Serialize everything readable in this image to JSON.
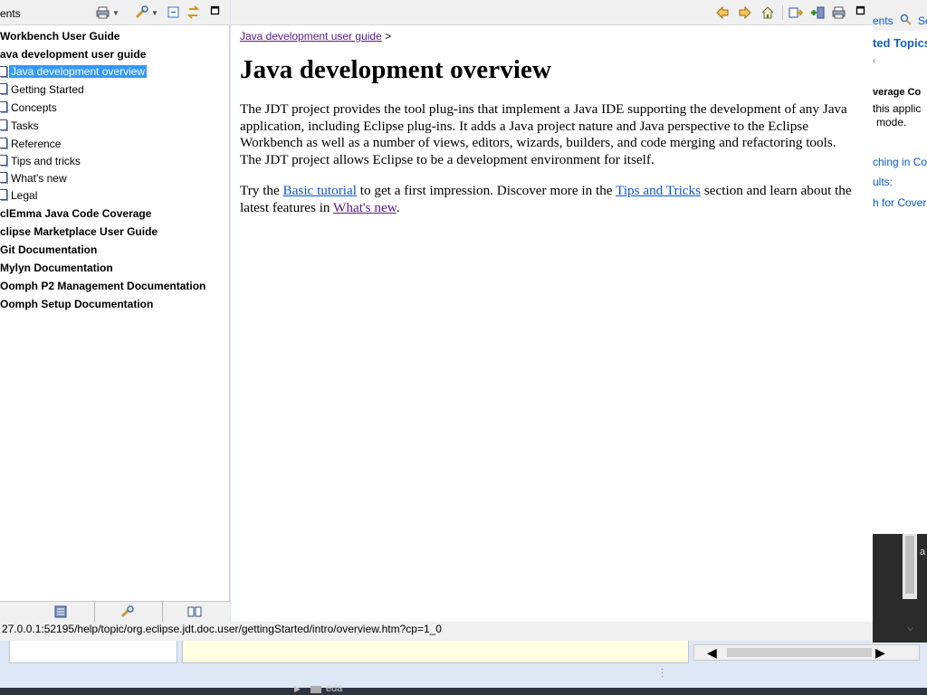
{
  "left_panel": {
    "title": "ents",
    "toc": [
      {
        "label": "Workbench User Guide",
        "kind": "book"
      },
      {
        "label": "ava development user guide",
        "kind": "book"
      },
      {
        "label": "Java development overview",
        "kind": "page",
        "selected": true
      },
      {
        "label": "Getting Started",
        "kind": "page"
      },
      {
        "label": "Concepts",
        "kind": "page"
      },
      {
        "label": "Tasks",
        "kind": "page"
      },
      {
        "label": "Reference",
        "kind": "page"
      },
      {
        "label": "Tips and tricks",
        "kind": "page"
      },
      {
        "label": "What's new",
        "kind": "page"
      },
      {
        "label": "Legal",
        "kind": "page"
      },
      {
        "label": "clEmma Java Code Coverage",
        "kind": "book"
      },
      {
        "label": "clipse Marketplace User Guide",
        "kind": "book"
      },
      {
        "label": "Git Documentation",
        "kind": "book"
      },
      {
        "label": "Mylyn Documentation",
        "kind": "book"
      },
      {
        "label": "Oomph P2 Management Documentation",
        "kind": "book"
      },
      {
        "label": "Oomph Setup Documentation",
        "kind": "book"
      }
    ],
    "bottom_tabs": [
      "contents-tab-icon",
      "search-tab-icon",
      "bookmarks-tab-icon"
    ]
  },
  "main": {
    "breadcrumb_link": "Java development user guide",
    "breadcrumb_sep": ">",
    "title": "Java development overview",
    "p1": "The JDT project provides the tool plug-ins that implement a Java IDE supporting the development of any Java application, including Eclipse plug-ins. It adds a Java project nature and Java perspective to the Eclipse Workbench as well as a number of views, editors, wizards, builders, and code merging and refactoring tools. The JDT project allows Eclipse to be a development environment for itself.",
    "p2_a": "Try the ",
    "p2_link1": "Basic tutorial",
    "p2_b": " to get a first impression. Discover more in the ",
    "p2_link2": "Tips and Tricks",
    "p2_c": " section and learn about the latest features in ",
    "p2_link3": "What's new",
    "p2_d": "."
  },
  "right_panel": {
    "tab1": "ents",
    "tab2": "Se",
    "heading": "ted Topics",
    "line1": "verage Co",
    "line2": "this applic",
    "line3": "mode.",
    "link1": "ching in Co",
    "link2": "ults:",
    "link3": "h for Cover"
  },
  "status_bar": {
    "url": "27.0.0.1:52195/help/topic/org.eclipse.jdt.doc.user/gettingStarted/intro/overview.htm?cp=1_0"
  },
  "background": {
    "taskbar_label": "eda",
    "side_text": "a"
  },
  "colors": {
    "selection": "#3399ff",
    "link": "#0b57d0",
    "visited": "#551a8b",
    "toolbar_bg": "#f0f0f0"
  }
}
